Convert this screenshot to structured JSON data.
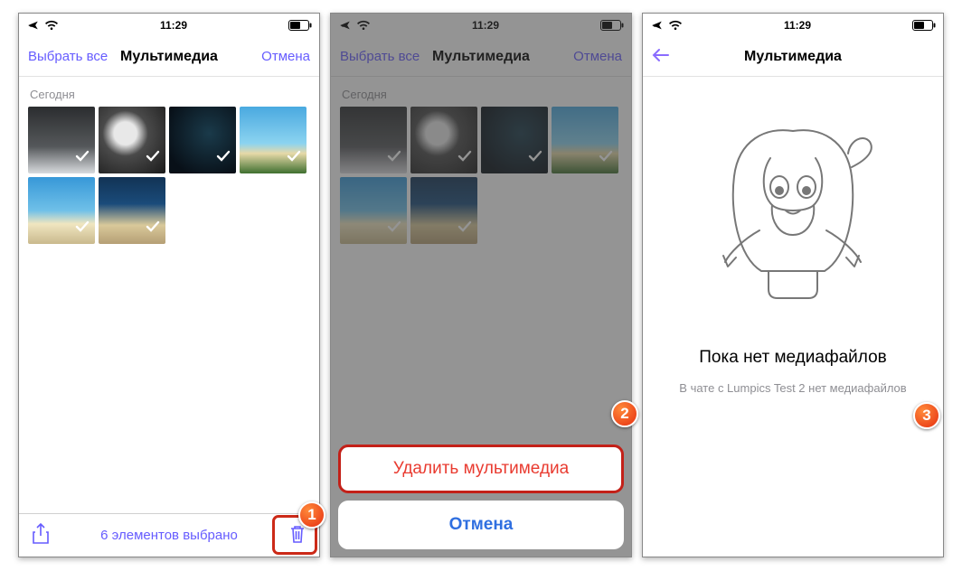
{
  "status": {
    "time": "11:29"
  },
  "panel1": {
    "select_all": "Выбрать все",
    "title": "Мультимедиа",
    "cancel": "Отмена",
    "section": "Сегодня",
    "selected_count": "6 элементов выбрано",
    "thumbs": [
      {
        "name": "thumb-gradient-monochrome"
      },
      {
        "name": "thumb-dice"
      },
      {
        "name": "thumb-dark-space"
      },
      {
        "name": "thumb-palm-beach"
      },
      {
        "name": "thumb-tropical-beach"
      },
      {
        "name": "thumb-night-beach"
      }
    ]
  },
  "panel2": {
    "select_all": "Выбрать все",
    "title": "Мультимедиа",
    "cancel": "Отмена",
    "section": "Сегодня",
    "delete_label": "Удалить мультимедиа",
    "cancel_sheet": "Отмена"
  },
  "panel3": {
    "title": "Мультимедиа",
    "empty_title": "Пока нет медиафайлов",
    "empty_sub": "В чате с Lumpics Test 2 нет медиафайлов"
  },
  "badges": {
    "b1": "1",
    "b2": "2",
    "b3": "3"
  }
}
